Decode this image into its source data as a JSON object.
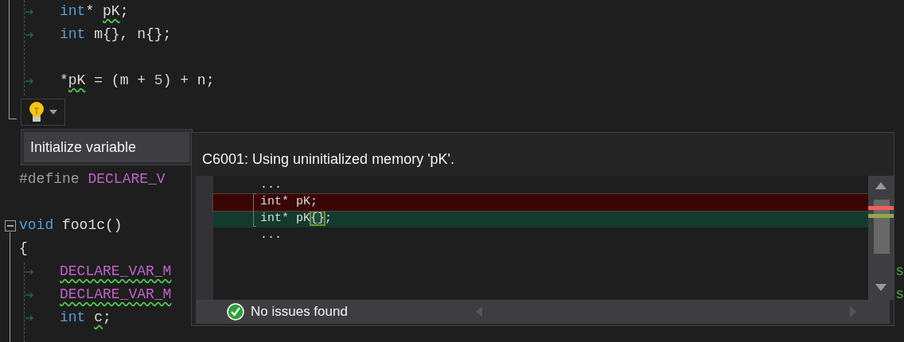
{
  "editor": {
    "lines_before": [
      {
        "kind": "code",
        "indented": true,
        "collapsible": false,
        "tokens": [
          {
            "text": "int",
            "kind": "keyword"
          },
          {
            "text": "* ",
            "kind": "plain"
          },
          {
            "text": "pK",
            "kind": "warn"
          },
          {
            "text": ";",
            "kind": "plain"
          }
        ]
      },
      {
        "kind": "code",
        "indented": true,
        "collapsible": false,
        "tokens": [
          {
            "text": "int",
            "kind": "keyword"
          },
          {
            "text": " m{}, n{};",
            "kind": "plain"
          }
        ]
      },
      {
        "kind": "blank"
      },
      {
        "kind": "code",
        "indented": true,
        "collapsible": false,
        "tokens": [
          {
            "text": "*",
            "kind": "plain"
          },
          {
            "text": "pK",
            "kind": "warn"
          },
          {
            "text": " = (m + ",
            "kind": "plain"
          },
          {
            "text": "5",
            "kind": "number"
          },
          {
            "text": ") + n;",
            "kind": "plain"
          }
        ]
      }
    ],
    "lines_after": [
      {
        "kind": "code",
        "indented": false,
        "collapsible": false,
        "tokens": [
          {
            "text": "#define",
            "kind": "directive"
          },
          {
            "text": " DECLARE_V",
            "kind": "macro"
          }
        ]
      },
      {
        "kind": "blank"
      },
      {
        "kind": "code",
        "indented": false,
        "collapsible": true,
        "tokens": [
          {
            "text": "void",
            "kind": "keyword"
          },
          {
            "text": " foo1c()",
            "kind": "plain"
          }
        ]
      },
      {
        "kind": "code",
        "indented": false,
        "collapsible": false,
        "tokens": [
          {
            "text": "{",
            "kind": "plain"
          }
        ]
      },
      {
        "kind": "code",
        "indented": true,
        "collapsible": false,
        "tokens": [
          {
            "text": "DECLARE_VAR_M",
            "kind": "macro-warn"
          }
        ],
        "tail": "s"
      },
      {
        "kind": "code",
        "indented": true,
        "collapsible": false,
        "tokens": [
          {
            "text": "DECLARE_VAR_M",
            "kind": "macro-warn"
          }
        ],
        "tail": "s"
      },
      {
        "kind": "code",
        "indented": true,
        "collapsible": false,
        "tokens": [
          {
            "text": "int ",
            "kind": "keyword"
          },
          {
            "text": "c",
            "kind": "warn"
          },
          {
            "text": ";",
            "kind": "plain"
          }
        ]
      }
    ]
  },
  "quick_actions": {
    "menu": [
      {
        "label": "Initialize variable",
        "selected": true
      }
    ]
  },
  "preview": {
    "title": "C6001: Using uninitialized memory 'pK'.",
    "lines": [
      {
        "kind": "context",
        "tokens": [
          {
            "text": "...",
            "kind": "plain"
          }
        ]
      },
      {
        "kind": "removed",
        "tokens": [
          {
            "text": "int* pK;",
            "kind": "plain"
          }
        ]
      },
      {
        "kind": "added",
        "tokens": [
          {
            "text": "int* pK",
            "kind": "plain"
          },
          {
            "text": "{}",
            "kind": "change"
          },
          {
            "text": ";",
            "kind": "plain"
          }
        ]
      },
      {
        "kind": "context",
        "tokens": [
          {
            "text": "...",
            "kind": "plain"
          }
        ]
      }
    ],
    "status": "No issues found"
  }
}
